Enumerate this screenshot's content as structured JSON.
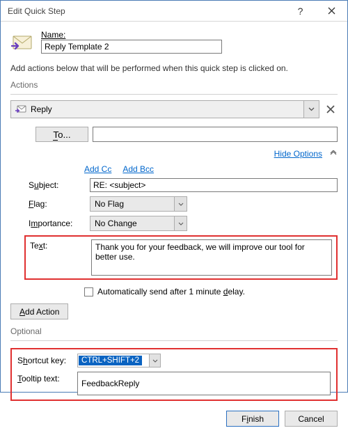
{
  "titlebar": {
    "title": "Edit Quick Step"
  },
  "name": {
    "label": "Name:",
    "value": "Reply Template 2"
  },
  "description": "Add actions below that will be performed when this quick step is clicked on.",
  "actions": {
    "section_label": "Actions",
    "selected_action": "Reply",
    "to_label": "To...",
    "hide_options": "Hide Options",
    "add_cc": "Add Cc",
    "add_bcc": "Add Bcc",
    "subject_label": "Subject:",
    "subject_value": "RE: <subject>",
    "flag_label": "Flag:",
    "flag_value": "No Flag",
    "importance_label": "Importance:",
    "importance_value": "No Change",
    "text_label": "Text:",
    "text_value": "Thank you for your feedback, we will improve our tool for better use.",
    "auto_send": "Automatically send after 1 minute delay.",
    "add_action": "Add Action"
  },
  "optional": {
    "section_label": "Optional",
    "shortcut_label": "Shortcut key:",
    "shortcut_value": "CTRL+SHIFT+2",
    "tooltip_label": "Tooltip text:",
    "tooltip_value": "FeedbackReply"
  },
  "footer": {
    "finish": "Finish",
    "cancel": "Cancel"
  }
}
